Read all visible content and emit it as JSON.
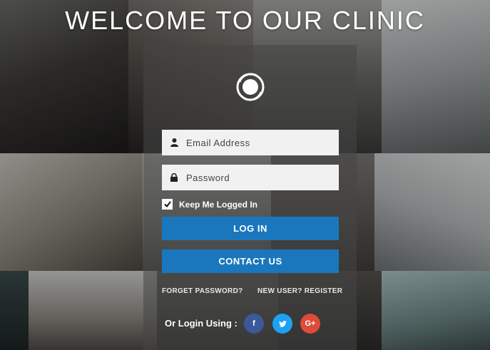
{
  "header": {
    "title": "WELCOME TO OUR CLINIC"
  },
  "login_form": {
    "email_placeholder": "Email Address",
    "password_placeholder": "Password",
    "remember_label": "Keep Me Logged In",
    "remember_checked": true,
    "login_label": "LOG IN",
    "contact_label": "CONTACT US",
    "forget_password_label": "FORGET PASSWORD?",
    "register_label": "NEW USER? REGISTER"
  },
  "social": {
    "label": "Or Login Using :",
    "facebook": "f",
    "google": "G+"
  },
  "colors": {
    "button": "#1a77bd",
    "facebook": "#3b5998",
    "twitter": "#1da1f2",
    "google": "#dd4b39"
  },
  "icons": [
    "logo-icon",
    "user-icon",
    "lock-icon",
    "checkmark-icon",
    "facebook-icon",
    "twitter-icon",
    "google-plus-icon"
  ]
}
